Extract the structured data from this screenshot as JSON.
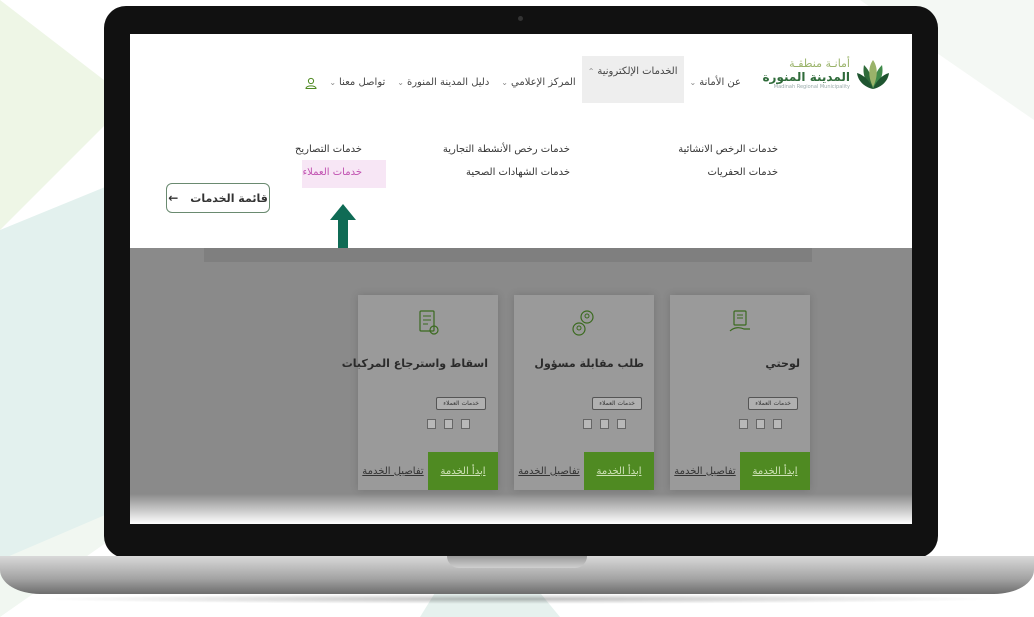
{
  "header": {
    "logo": {
      "line1": "أمانـة منطقـة",
      "line2": "المدينة المنورة",
      "line3": "Madinah Regional Municipality"
    },
    "nav": [
      {
        "label": "عن الأمانة",
        "active": false
      },
      {
        "label": "الخدمات الإلكترونية",
        "active": true
      },
      {
        "label": "المركز الإعلامي",
        "active": false
      },
      {
        "label": "دليل المدينة المنورة",
        "active": false
      },
      {
        "label": "تواصل معنا",
        "active": false
      }
    ]
  },
  "menu": {
    "col1": [
      "خدمات الرخص الانشائية",
      "خدمات الحفريات"
    ],
    "col2": [
      "خدمات رخص الأنشطة التجارية",
      "خدمات الشهادات الصحية"
    ],
    "col3": [
      "خدمات التصاريح",
      "خدمات العملاء"
    ],
    "highlighted": "خدمات العملاء"
  },
  "services_list_button": {
    "label": "قائمة الخدمات"
  },
  "cards": [
    {
      "title": "لوحتي",
      "badge": "خدمات العملاء",
      "start": "ابدأ الخدمة",
      "details": "تفاصيل الخدمة",
      "icon": "id-card-icon"
    },
    {
      "title": "طلب مقابلة مسؤول",
      "badge": "خدمات العملاء",
      "start": "ابدأ الخدمة",
      "details": "تفاصيل الخدمة",
      "icon": "person-meeting-icon"
    },
    {
      "title": "اسقاط واسترجاع المركبات",
      "badge": "خدمات العملاء",
      "start": "ابدأ الخدمة",
      "details": "تفاصيل الخدمة",
      "icon": "document-icon"
    }
  ],
  "colors": {
    "brand_green": "#2f6b3a",
    "start_button": "#4f8a22",
    "highlight": "#f7e6f5",
    "arrow": "#0f6b55"
  }
}
